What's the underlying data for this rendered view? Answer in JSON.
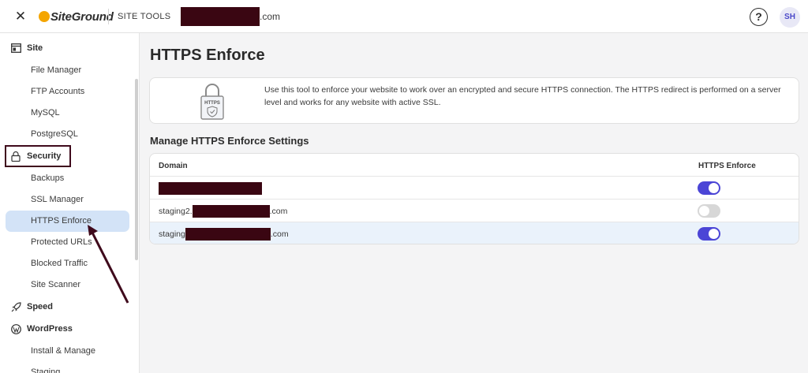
{
  "header": {
    "close_icon": "close-icon",
    "logo_text": "SiteGround",
    "site_tools": "SITE TOOLS",
    "domain_suffix": ".com",
    "help_label": "?",
    "avatar_initials": "SH"
  },
  "sidebar": {
    "sections": {
      "site": "Site",
      "security": "Security",
      "speed": "Speed",
      "wordpress": "WordPress"
    },
    "site_items": [
      "File Manager",
      "FTP Accounts",
      "MySQL",
      "PostgreSQL"
    ],
    "security_items": [
      "Backups",
      "SSL Manager",
      "HTTPS Enforce",
      "Protected URLs",
      "Blocked Traffic",
      "Site Scanner"
    ],
    "wordpress_items": [
      "Install & Manage",
      "Staging"
    ],
    "active_item": "HTTPS Enforce"
  },
  "main": {
    "title": "HTTPS Enforce",
    "info_icon_label": "HTTPS",
    "info_text": "Use this tool to enforce your website to work over an encrypted and secure HTTPS connection. The HTTPS redirect is performed on a server level and works for any website with active SSL.",
    "section_title": "Manage HTTPS Enforce Settings",
    "table": {
      "col_domain": "Domain",
      "col_enforce": "HTTPS Enforce",
      "rows": [
        {
          "prefix": "",
          "suffix": "",
          "enforce": true
        },
        {
          "prefix": "staging2.",
          "suffix": ".com",
          "enforce": false
        },
        {
          "prefix": "staging",
          "suffix": ".com",
          "enforce": true
        }
      ]
    }
  },
  "colors": {
    "accent": "#4b45d6",
    "redaction": "#3a0612",
    "annotation": "#3f0a1c",
    "active_item_bg": "#d3e3f7"
  }
}
